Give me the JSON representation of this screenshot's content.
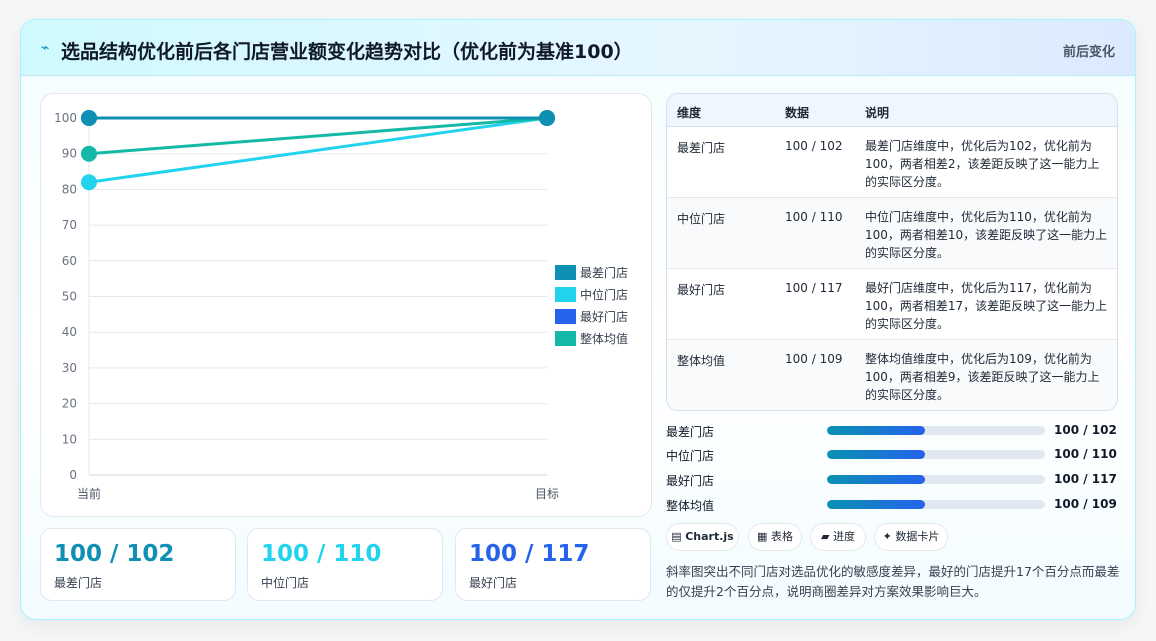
{
  "header": {
    "title": "选品结构优化前后各门店营业额变化趋势对比（优化前为基准100）",
    "icon": "sparkline-icon",
    "right_label": "前后变化"
  },
  "chart_data": {
    "type": "line",
    "x": [
      "当前",
      "目标"
    ],
    "ylim": [
      0,
      100
    ],
    "yticks": [
      0,
      10,
      20,
      30,
      40,
      50,
      60,
      70,
      80,
      90,
      100
    ],
    "grid": true,
    "legend_position": "right",
    "series": [
      {
        "name": "最差门店",
        "values": [
          100,
          100
        ],
        "color": "#0e8fb3"
      },
      {
        "name": "中位门店",
        "values": [
          82,
          100
        ],
        "color": "#22d3ee"
      },
      {
        "name": "最好门店",
        "values": [
          100,
          100
        ],
        "color": "#2563eb"
      },
      {
        "name": "整体均值",
        "values": [
          90,
          100
        ],
        "color": "#14b8a6"
      }
    ]
  },
  "kpis": [
    {
      "value": "100 / 102",
      "label": "最差门店",
      "color": "#0e8fb3"
    },
    {
      "value": "100 / 110",
      "label": "中位门店",
      "color": "#22d3ee"
    },
    {
      "value": "100 / 117",
      "label": "最好门店",
      "color": "#2563eb"
    }
  ],
  "table": {
    "headers": [
      "维度",
      "数据",
      "说明"
    ],
    "rows": [
      {
        "dim": "最差门店",
        "data": "100 / 102",
        "desc": "最差门店维度中，优化后为102，优化前为100，两者相差2，该差距反映了这一能力上的实际区分度。"
      },
      {
        "dim": "中位门店",
        "data": "100 / 110",
        "desc": "中位门店维度中，优化后为110，优化前为100，两者相差10，该差距反映了这一能力上的实际区分度。"
      },
      {
        "dim": "最好门店",
        "data": "100 / 117",
        "desc": "最好门店维度中，优化后为117，优化前为100，两者相差17，该差距反映了这一能力上的实际区分度。"
      },
      {
        "dim": "整体均值",
        "data": "100 / 109",
        "desc": "整体均值维度中，优化后为109，优化前为100，两者相差9，该差距反映了这一能力上的实际区分度。"
      }
    ]
  },
  "progress": [
    {
      "label": "最差门店",
      "value": "100 / 102",
      "fill_pct": 45
    },
    {
      "label": "中位门店",
      "value": "100 / 110",
      "fill_pct": 45
    },
    {
      "label": "最好门店",
      "value": "100 / 117",
      "fill_pct": 45
    },
    {
      "label": "整体均值",
      "value": "100 / 109",
      "fill_pct": 45
    }
  ],
  "chips": [
    {
      "label": "Chart.js",
      "icon": "chart-icon",
      "glyph": "▤"
    },
    {
      "label": "表格",
      "icon": "table-icon",
      "glyph": "▦"
    },
    {
      "label": "进度",
      "icon": "progress-icon",
      "glyph": "▰"
    },
    {
      "label": "数据卡片",
      "icon": "sparkle-icon",
      "glyph": "✦"
    }
  ],
  "note": "斜率图突出不同门店对选品优化的敏感度差异，最好的门店提升17个百分点而最差的仅提升2个百分点，说明商圈差异对方案效果影响巨大。"
}
